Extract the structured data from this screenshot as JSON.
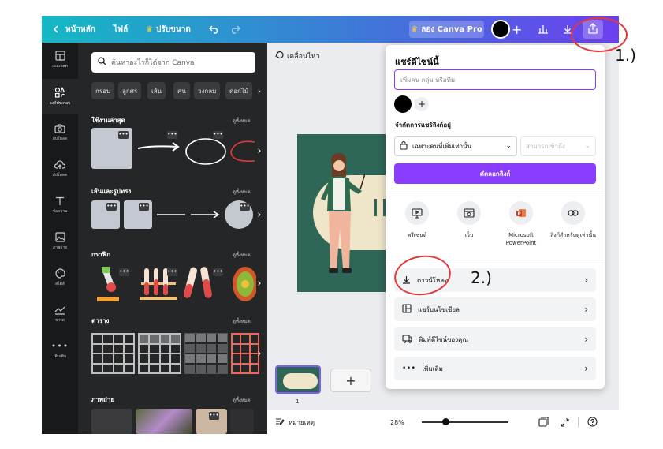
{
  "topbar": {
    "back_label": "หน้าหลัก",
    "file_label": "ไฟล์",
    "resize_label": "ปรับขนาด",
    "try_pro_label": "ลอง Canva Pro",
    "colors": {
      "gradient_start": "#14b8c4",
      "gradient_end": "#6c3ff0"
    }
  },
  "rail": {
    "items": [
      {
        "label": "เทมเพลต",
        "icon": "layout-icon"
      },
      {
        "label": "องค์ประกอบ",
        "icon": "elements-icon"
      },
      {
        "label": "อัปโหลด",
        "icon": "camera-icon"
      },
      {
        "label": "อัปโหลด",
        "icon": "upload-cloud-icon"
      },
      {
        "label": "ข้อความ",
        "icon": "text-icon"
      },
      {
        "label": "ภาพถ่าย",
        "icon": "image-icon"
      },
      {
        "label": "สไตล์",
        "icon": "palette-icon"
      },
      {
        "label": "ชาร์ต",
        "icon": "chart-icon"
      },
      {
        "label": "เพิ่มเติม",
        "icon": "more-icon"
      }
    ]
  },
  "panel": {
    "search_placeholder": "ค้นหาอะไรก็ได้จาก Canva",
    "chips": [
      "กรอบ",
      "ลูกศร",
      "เส้น",
      "คน",
      "วงกลม",
      "ดอกไม้"
    ],
    "sections": {
      "recent": "ใช้งานล่าสุด",
      "lines_shapes": "เส้นและรูปทรง",
      "graphics": "กราฟิก",
      "tables": "ตาราง",
      "photos": "ภาพถ่าย"
    },
    "see_all": "ดูทั้งหมด"
  },
  "canvas": {
    "motion_label": "เคลื่อนไหว",
    "page_number": "1",
    "notes_label": "หมายเหตุ",
    "zoom_level": "28%",
    "zoom_fraction": 0.28
  },
  "share": {
    "title": "แชร์ดีไซน์นี้",
    "input_placeholder": "เพิ่มคน กลุ่ม หรือทีม",
    "access_label": "จำกัดการแชร์ลิงก์อยู่",
    "access_value": "เฉพาะคนที่เพิ่มเท่านั้น",
    "permission_value": "สามารถเข้าถึง",
    "copy_link_label": "คัดลอกลิงก์",
    "options": [
      {
        "label": "พรีเซนต์",
        "icon": "present-icon"
      },
      {
        "label": "เว็บ",
        "icon": "web-icon"
      },
      {
        "label": "Microsoft PowerPoint",
        "icon": "powerpoint-icon"
      },
      {
        "label": "ลิงก์สำหรับดูเท่านั้น",
        "icon": "link-icon"
      }
    ],
    "rows": [
      {
        "label": "ดาวน์โหลด",
        "icon": "download-icon"
      },
      {
        "label": "แชร์บนโซเชียล",
        "icon": "social-icon"
      },
      {
        "label": "พิมพ์ดีไซน์ของคุณ",
        "icon": "print-icon"
      },
      {
        "label": "เพิ่มเติม",
        "icon": "more-dots-icon"
      }
    ]
  },
  "annotations": {
    "step1": "1.)",
    "step2": "2.)",
    "color": "#e23a3a"
  }
}
